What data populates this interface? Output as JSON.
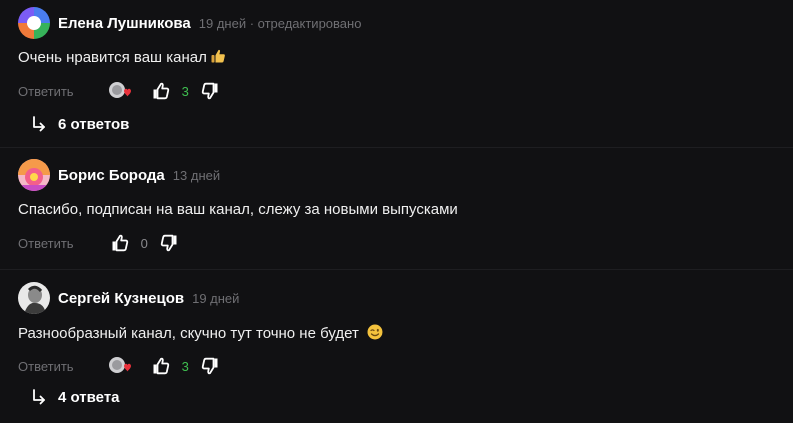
{
  "comments": [
    {
      "author": "Елена Лушникова",
      "meta": "19 дней · отредактировано",
      "text": "Очень нравится ваш канал",
      "reply_label": "Ответить",
      "likes": "3",
      "replies_label": "6 ответов",
      "has_author_like": true,
      "avatar": "avatar-colorful-quadrants"
    },
    {
      "author": "Борис Борода",
      "meta": "13 дней",
      "text": "Спасибо, подписан на ваш канал, слежу за новыми выпусками",
      "reply_label": "Ответить",
      "likes": "0",
      "has_author_like": false,
      "avatar": "avatar-pink-yellow-flower"
    },
    {
      "author": "Сергей Кузнецов",
      "meta": "19 дней",
      "text": "Разнообразный канал, скучно тут точно не будет",
      "reply_label": "Ответить",
      "likes": "3",
      "replies_label": "4 ответа",
      "has_author_like": true,
      "avatar": "avatar-photo-grayscale"
    }
  ],
  "colors": {
    "background": "#111113",
    "muted_text": "#6f6f73",
    "positive_count": "#3fbf50",
    "heart": "#e8313b"
  },
  "icons": {
    "like": "thumbs-up-icon",
    "dislike": "thumbs-down-icon",
    "author_heart": "author-heart-icon",
    "reply_arrow": "reply-arrow-icon",
    "thumbs_emoji": "thumbs-up-emoji",
    "wink_emoji": "winking-face-emoji"
  }
}
